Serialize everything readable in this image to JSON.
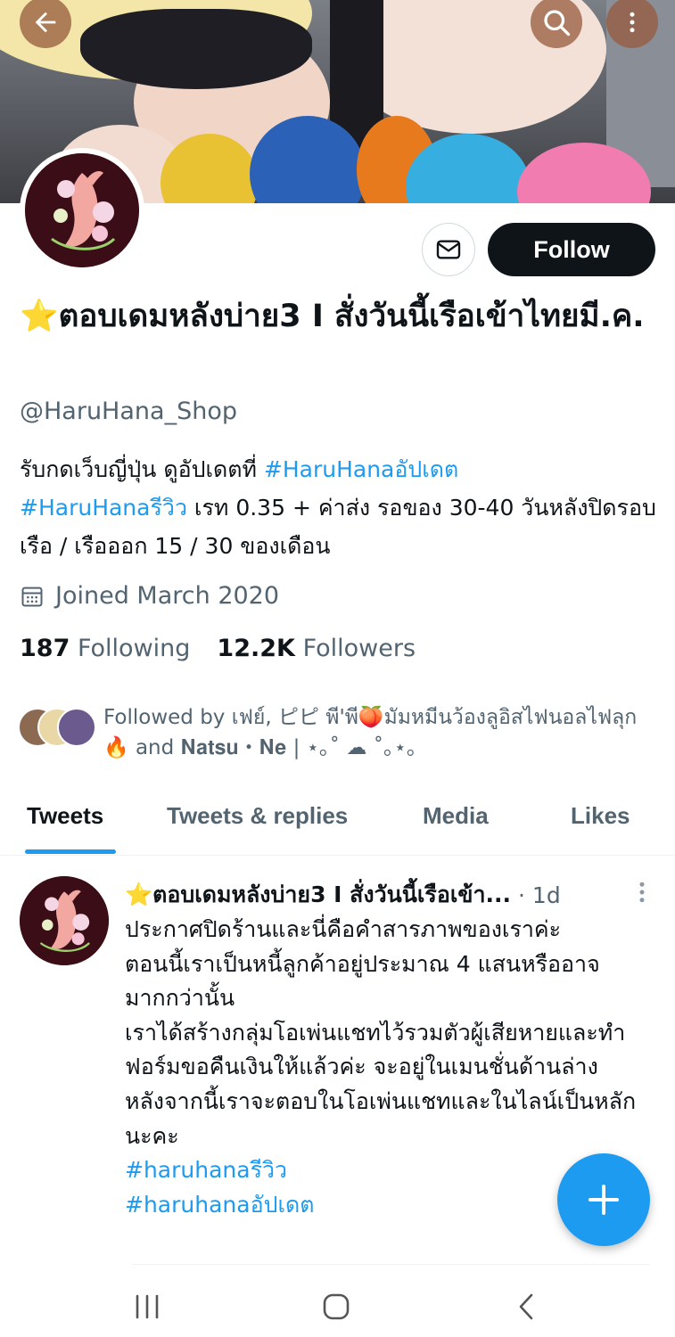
{
  "profile": {
    "display_name": "ตอบเดมหลังบ่าย3 I สั่งวันนี้เรือเข้าไทยมี.ค.",
    "star_emoji": "⭐",
    "handle": "@HaruHana_Shop",
    "bio_prefix": "รับกดเว็บญี่ปุ่น ดูอัปเดตที่ ",
    "bio_tag1": "#HaruHanaอัปเดต",
    "bio_tag2": "#HaruHanaรีวิว",
    "bio_suffix": " เรท 0.35 + ค่าส่ง รอของ 30-40 วันหลังปิดรอบเรือ / เรือออก 15 / 30 ของเดือน",
    "joined": "Joined March 2020",
    "following_count": "187",
    "following_label": "Following",
    "followers_count": "12.2K",
    "followers_label": "Followers",
    "followed_by": "Followed by เฟย์, ピピ พี'พี🍑มัมหมีนว้องลูอิสไฟนอลไฟลุก🔥 and 𝐍𝐚𝐭𝐬𝐮・𝐍𝐞 | ⋆｡˚ ☁︎ ˚｡⋆｡"
  },
  "buttons": {
    "follow": "Follow"
  },
  "tabs": [
    {
      "label": "Tweets",
      "active": true
    },
    {
      "label": "Tweets & replies",
      "active": false
    },
    {
      "label": "Media",
      "active": false
    },
    {
      "label": "Likes",
      "active": false
    }
  ],
  "tweet": {
    "author": "⭐ตอบเดมหลังบ่าย3 I สั่งวันนี้เรือเข้า...",
    "time": "· 1d",
    "lines": [
      "ประกาศปิดร้านและนี่คือคำสารภาพของเราค่ะ",
      "ตอนนี้เราเป็นหนี้ลูกค้าอยู่ประมาณ 4 แสนหรืออาจมากกว่านั้น",
      "เราได้สร้างกลุ่มโอเพ่นแชทไว้รวมตัวผู้เสียหายและทำฟอร์มขอคืนเงินให้แล้วค่ะ จะอยู่ในเมนชั่นด้านล่าง",
      "หลังจากนี้เราจะตอบในโอเพ่นแชทและในไลน์เป็นหลักนะคะ"
    ],
    "tag1": "#haruhanaรีวิว",
    "tag2": "#haruhanaอัปเดต"
  },
  "icons": {
    "back": "arrow-left-icon",
    "search": "search-icon",
    "more": "more-vertical-icon",
    "message": "envelope-icon",
    "calendar": "calendar-icon",
    "compose": "plus-icon"
  },
  "colors": {
    "accent": "#1d9bf0",
    "text": "#0f1419",
    "secondary": "#536471",
    "follow_bg": "#0f1419"
  }
}
